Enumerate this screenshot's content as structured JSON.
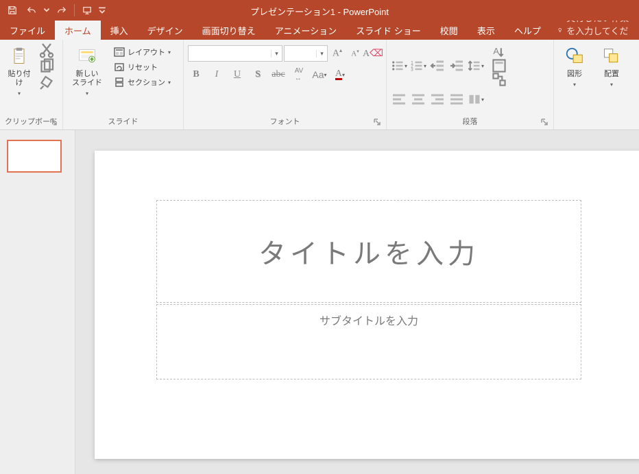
{
  "title": "プレゼンテーション1 - PowerPoint",
  "tabs": {
    "file": "ファイル",
    "home": "ホーム",
    "insert": "挿入",
    "design": "デザイン",
    "transitions": "画面切り替え",
    "animations": "アニメーション",
    "slideshow": "スライド ショー",
    "review": "校閲",
    "view": "表示",
    "help": "ヘルプ",
    "search_hint": "実行したい作業を入力してください"
  },
  "ribbon": {
    "clipboard": {
      "label": "クリップボード",
      "paste": "貼り付け"
    },
    "slides": {
      "label": "スライド",
      "new_slide": "新しい\nスライド",
      "layout": "レイアウト",
      "reset": "リセット",
      "section": "セクション"
    },
    "font": {
      "label": "フォント"
    },
    "paragraph": {
      "label": "段落"
    },
    "drawing": {
      "shapes": "図形",
      "arrange": "配置"
    }
  },
  "slide": {
    "title_placeholder": "タイトルを入力",
    "subtitle_placeholder": "サブタイトルを入力"
  }
}
